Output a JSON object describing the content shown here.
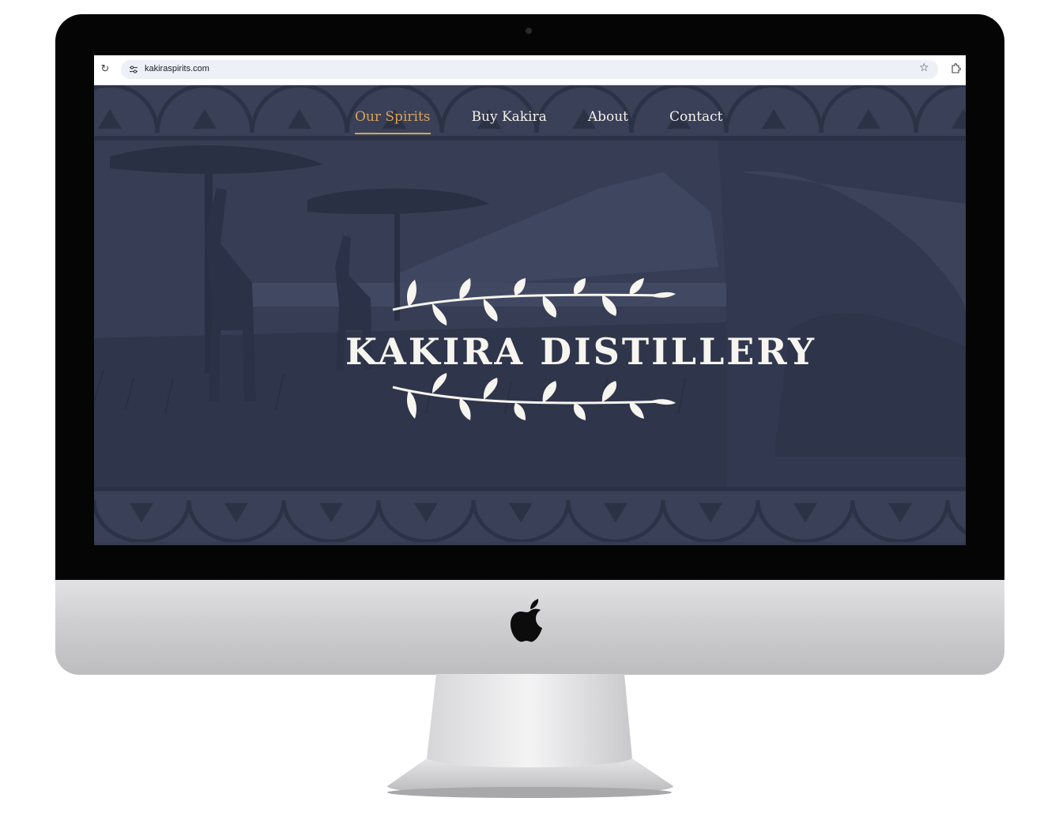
{
  "browser": {
    "url": "kakiraspirits.com"
  },
  "nav": {
    "items": [
      {
        "label": "Our Spirits",
        "active": true
      },
      {
        "label": "Buy Kakira",
        "active": false
      },
      {
        "label": "About",
        "active": false
      },
      {
        "label": "Contact",
        "active": false
      }
    ]
  },
  "hero": {
    "logo_text": "KAKIRA DISTILLERY"
  },
  "icons": {
    "reload": "reload-icon",
    "site_info": "site-info-icon",
    "bookmark": "star-icon",
    "extensions": "puzzle-icon",
    "brand": "apple-logo"
  },
  "colors": {
    "site_background": "#343b52",
    "nav_active": "#d9a35a",
    "nav_text": "#f2f0ea",
    "logo": "#f7f5ef"
  }
}
